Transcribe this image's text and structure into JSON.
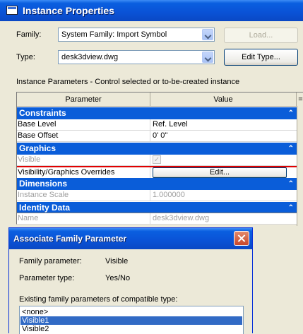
{
  "window": {
    "title": "Instance Properties"
  },
  "family": {
    "label": "Family:",
    "value": "System Family: Import Symbol"
  },
  "type": {
    "label": "Type:",
    "value": "desk3dview.dwg"
  },
  "buttons": {
    "load": "Load...",
    "edit_type": "Edit Type..."
  },
  "instance_params_caption": "Instance Parameters - Control selected or to-be-created instance",
  "grid": {
    "col_parameter": "Parameter",
    "col_value": "Value",
    "col_extra": "=",
    "categories": {
      "constraints": "Constraints",
      "graphics": "Graphics",
      "dimensions": "Dimensions",
      "identity": "Identity Data"
    },
    "rows": {
      "base_level": {
        "name": "Base Level",
        "value": "Ref. Level"
      },
      "base_offset": {
        "name": "Base Offset",
        "value": "0'  0\""
      },
      "visible": {
        "name": "Visible",
        "value": "✓"
      },
      "vg_overrides": {
        "name": "Visibility/Graphics Overrides",
        "value": "Edit..."
      },
      "instance_scale": {
        "name": "Instance Scale",
        "value": "1.000000"
      },
      "name": {
        "name": "Name",
        "value": "desk3dview.dwg"
      }
    },
    "collapse_glyph": "⌃"
  },
  "dialog": {
    "title": "Associate Family Parameter",
    "family_param_label": "Family parameter:",
    "family_param_value": "Visible",
    "param_type_label": "Parameter type:",
    "param_type_value": "Yes/No",
    "existing_label": "Existing family parameters of compatible type:",
    "list": [
      "<none>",
      "Visible1",
      "Visible2"
    ],
    "selected_index": 1
  },
  "colors": {
    "titlebar": "#0a52d6",
    "category": "#0a5dd9",
    "highlight_line": "#e00000",
    "selection": "#316ac5"
  }
}
